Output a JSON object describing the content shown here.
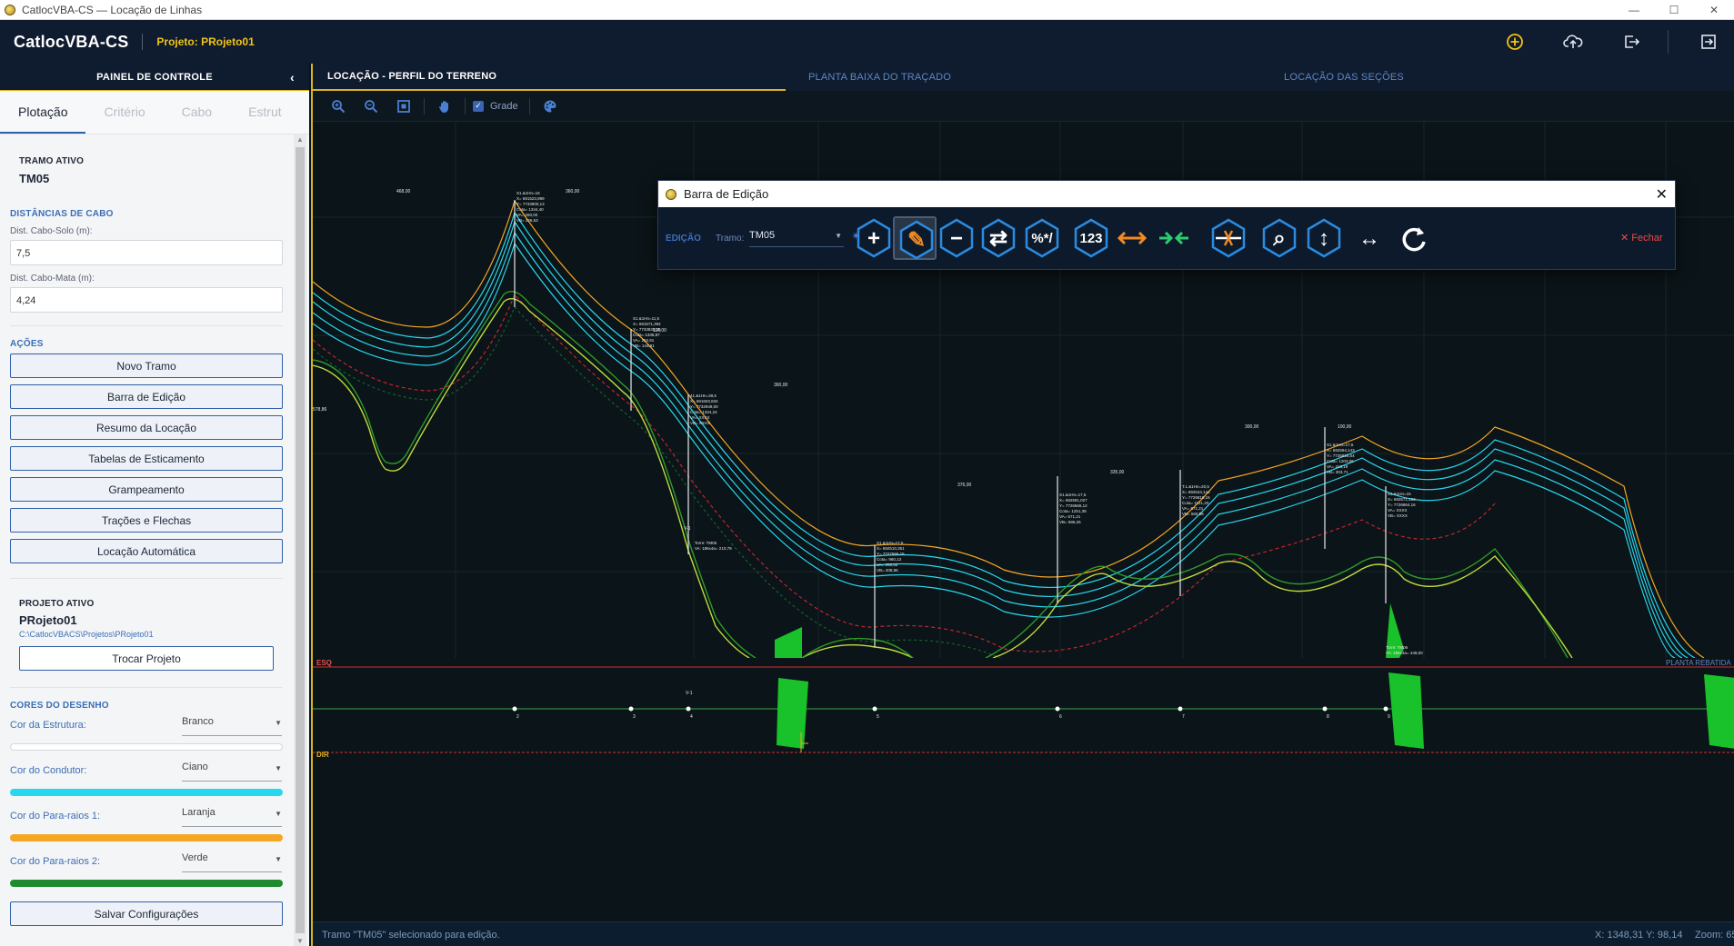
{
  "window": {
    "title": "CatlocVBA-CS — Locação de Linhas",
    "controls": [
      "—",
      "☐",
      "✕"
    ]
  },
  "header": {
    "brand": "CatlocVBA-CS",
    "project": "Projeto: PRojeto01",
    "icons": [
      "add-circle-icon",
      "cloud-upload-icon",
      "export-icon",
      "logout-icon"
    ]
  },
  "sidebar": {
    "panel_title": "PAINEL DE CONTROLE",
    "collapse_glyph": "‹",
    "tabs": [
      "Plotação",
      "Critério",
      "Cabo",
      "Estrut"
    ],
    "active_tab": "Plotação",
    "tramo": {
      "label": "TRAMO ATIVO",
      "value": "TM05"
    },
    "distancias": {
      "title": "DISTÂNCIAS DE CABO",
      "solo_label": "Dist. Cabo-Solo (m):",
      "solo_value": "7,5",
      "mata_label": "Dist. Cabo-Mata (m):",
      "mata_value": "4,24"
    },
    "acoes": {
      "title": "AÇÕES",
      "buttons": [
        "Novo Tramo",
        "Barra de Edição",
        "Resumo da Locação",
        "Tabelas de Esticamento",
        "Grampeamento",
        "Trações e Flechas",
        "Locação Automática"
      ]
    },
    "projeto": {
      "label": "PROJETO ATIVO",
      "name": "PRojeto01",
      "path": "C:\\CatlocVBACS\\Projetos\\PRojeto01",
      "button": "Trocar Projeto"
    },
    "cores": {
      "title": "CORES DO DESENHO",
      "rows": [
        {
          "label": "Cor da Estrutura:",
          "value": "Branco",
          "color": "#ffffff"
        },
        {
          "label": "Cor do Condutor:",
          "value": "Ciano",
          "color": "#27d7ee"
        },
        {
          "label": "Cor do Para-raios 1:",
          "value": "Laranja",
          "color": "#f5a623"
        },
        {
          "label": "Cor do Para-raios 2:",
          "value": "Verde",
          "color": "#1f8a2e"
        }
      ],
      "save_button": "Salvar Configurações"
    }
  },
  "main": {
    "tabs": [
      "LOCAÇÃO - PERFIL DO TERRENO",
      "PLANTA BAIXA DO TRAÇADO",
      "LOCAÇÃO DAS SEÇÕES"
    ],
    "toolbar": {
      "icons": [
        "zoom-in-icon",
        "zoom-out-icon",
        "fit-extents-icon",
        "pan-hand-icon",
        "palette-icon"
      ],
      "grade_label": "Grade",
      "grade_checked": true
    },
    "profile": {
      "span_labels": [
        "468,00",
        "360,00",
        "116,00",
        "360,00",
        "376,00",
        "335,00",
        "300,00",
        "100,00"
      ],
      "extra_labels": [
        "578,86",
        "V-1",
        "V-1"
      ],
      "plan_labels": {
        "esq": "ESQ",
        "dir": "DIR",
        "planta": "PLANTA REBATIDA"
      },
      "station_numbers": [
        "2",
        "3",
        "4",
        "5",
        "6",
        "7",
        "8",
        "9"
      ],
      "structures": [
        {
          "lines": [
            "S1.&1Hn=16",
            "X= 691523,999",
            "Y= 7733900,13",
            "Cota= 1344,40",
            "VA= 260,00",
            "VB= 226,53"
          ]
        },
        {
          "lines": [
            "S1.&1Hn=11,5",
            "X= 691571,394",
            "Y= 7733830,36",
            "Cota= 1335,87",
            "VA= 262,91",
            "VB= 144,91"
          ]
        },
        {
          "lines": [
            "41.&1Hn=39,5",
            "X= 691603,834",
            "Y= 7732948,00",
            "Cota= 1324,24",
            "VA= XXXX",
            "VB= XXXX"
          ]
        },
        {
          "lines": [
            "S1.&1Hn=17,5",
            "X= 692510,351",
            "Y= 7727566,15",
            "Cota= 960,13",
            "VA= 268,52",
            "VB= 208,96"
          ]
        },
        {
          "lines": [
            "S1.&1Hn=17,5",
            "X= 692591,027",
            "Y= 7726566,12",
            "Cota= 1251,38",
            "VA= 571,21",
            "VB= 586,25"
          ]
        },
        {
          "lines": [
            "T.1.&1Hn=20,5",
            "X= 692544,144",
            "Y= 7726810,15",
            "Cota= 1121,20",
            "VA= 571,21",
            "VB= 560,98"
          ]
        },
        {
          "lines": [
            "S1.&1Hn=17,5",
            "X= 692564,143",
            "Y= 7726825,04",
            "Cota= 1203,06",
            "VA= 413,19",
            "VB= 303,71"
          ]
        },
        {
          "lines": [
            "S1.&1Hn=15",
            "X= 692571,153",
            "Y= 7726864,16",
            "VA= XXXX",
            "VB= XXXX"
          ]
        }
      ],
      "bottom_labels": [
        {
          "lines": [
            "Torre: TM05",
            "VA: 186x4a= 210,79"
          ]
        },
        {
          "lines": [
            "Torre: TM06",
            "VA: 186x4a= 449,00"
          ]
        }
      ]
    }
  },
  "edit_bar": {
    "title": "Barra de Edição",
    "section_label": "EDIÇÃO",
    "tramo_label": "Tramo:",
    "tramo_value": "TM05",
    "tools": [
      {
        "name": "add-structure-icon",
        "glyph": "+"
      },
      {
        "name": "edit-structure-icon",
        "glyph": "✎"
      },
      {
        "name": "remove-structure-icon",
        "glyph": "−"
      },
      {
        "name": "swap-structure-icon",
        "glyph": "⇄"
      },
      {
        "name": "percent-calc-icon",
        "glyph": "%*/"
      },
      {
        "name": "numbering-icon",
        "glyph": "123"
      },
      {
        "name": "expand-span-icon",
        "glyph": "↔"
      },
      {
        "name": "shrink-span-icon",
        "glyph": "→←"
      },
      {
        "name": "cut-span-icon",
        "glyph": "✂"
      },
      {
        "name": "search-icon",
        "glyph": "⌕"
      },
      {
        "name": "vertical-measure-icon",
        "glyph": "↕"
      },
      {
        "name": "horizontal-measure-icon",
        "glyph": "↔"
      },
      {
        "name": "refresh-icon",
        "glyph": "↻"
      }
    ],
    "close_label": "✕ Fechar"
  },
  "status": {
    "message": "Tramo \"TM05\" selecionado para edição.",
    "coords": "X: 1348,31  Y: 98,14",
    "zoom": "Zoom: 65%"
  }
}
